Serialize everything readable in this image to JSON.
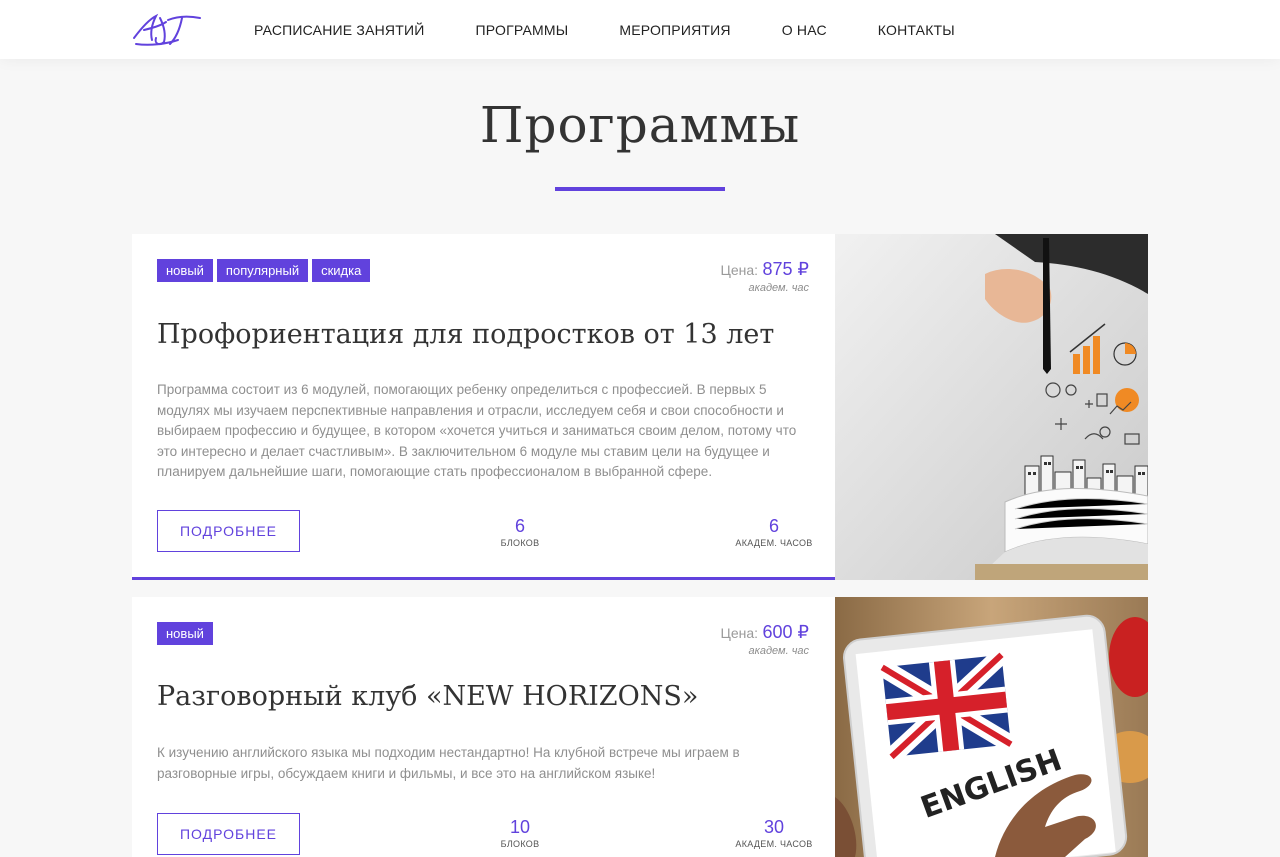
{
  "header": {
    "nav": [
      {
        "label": "Расписание занятий"
      },
      {
        "label": "Программы"
      },
      {
        "label": "Мероприятия"
      },
      {
        "label": "О нас"
      },
      {
        "label": "Контакты"
      }
    ]
  },
  "page": {
    "title": "Программы"
  },
  "theme": {
    "accent": "#6142dd",
    "background": "#f7f7f7"
  },
  "programs": [
    {
      "tags": [
        "новый",
        "популярный",
        "скидка"
      ],
      "price_label": "Цена:",
      "price_value": "875 ₽",
      "price_unit": "академ. час",
      "title": "Профориентация для подростков от 13 лет",
      "description": "Программа состоит из 6 модулей, помогающих ребенку определиться с профессией. В первых 5 модулях мы изучаем перспективные направления и отрасли, исследуем себя и свои способности и выбираем профессию и будущее, в котором «хочется учиться и заниматься своим делом, потому что это интересно и делает счастливым». В заключительном 6 модуле мы ставим цели на будущее и планируем дальнейшие шаги, помогающие стать профессионалом в выбранной сфере.",
      "button_label": "Подробнее",
      "blocks_value": "6",
      "blocks_label": "блоков",
      "hours_value": "6",
      "hours_label": "академ. часов",
      "image_icon": "career-planning-image"
    },
    {
      "tags": [
        "новый"
      ],
      "price_label": "Цена:",
      "price_value": "600 ₽",
      "price_unit": "академ. час",
      "title": "Разговорный клуб «NEW HORIZONS»",
      "description": "К изучению английского языка мы подходим нестандартно! На клубной встрече мы играем в разговорные игры, обсуждаем книги и фильмы, и все это на английском языке!",
      "button_label": "Подробнее",
      "blocks_value": "10",
      "blocks_label": "блоков",
      "hours_value": "30",
      "hours_label": "академ. часов",
      "image_icon": "english-tablet-image",
      "image_text": "ENGLISH"
    }
  ]
}
